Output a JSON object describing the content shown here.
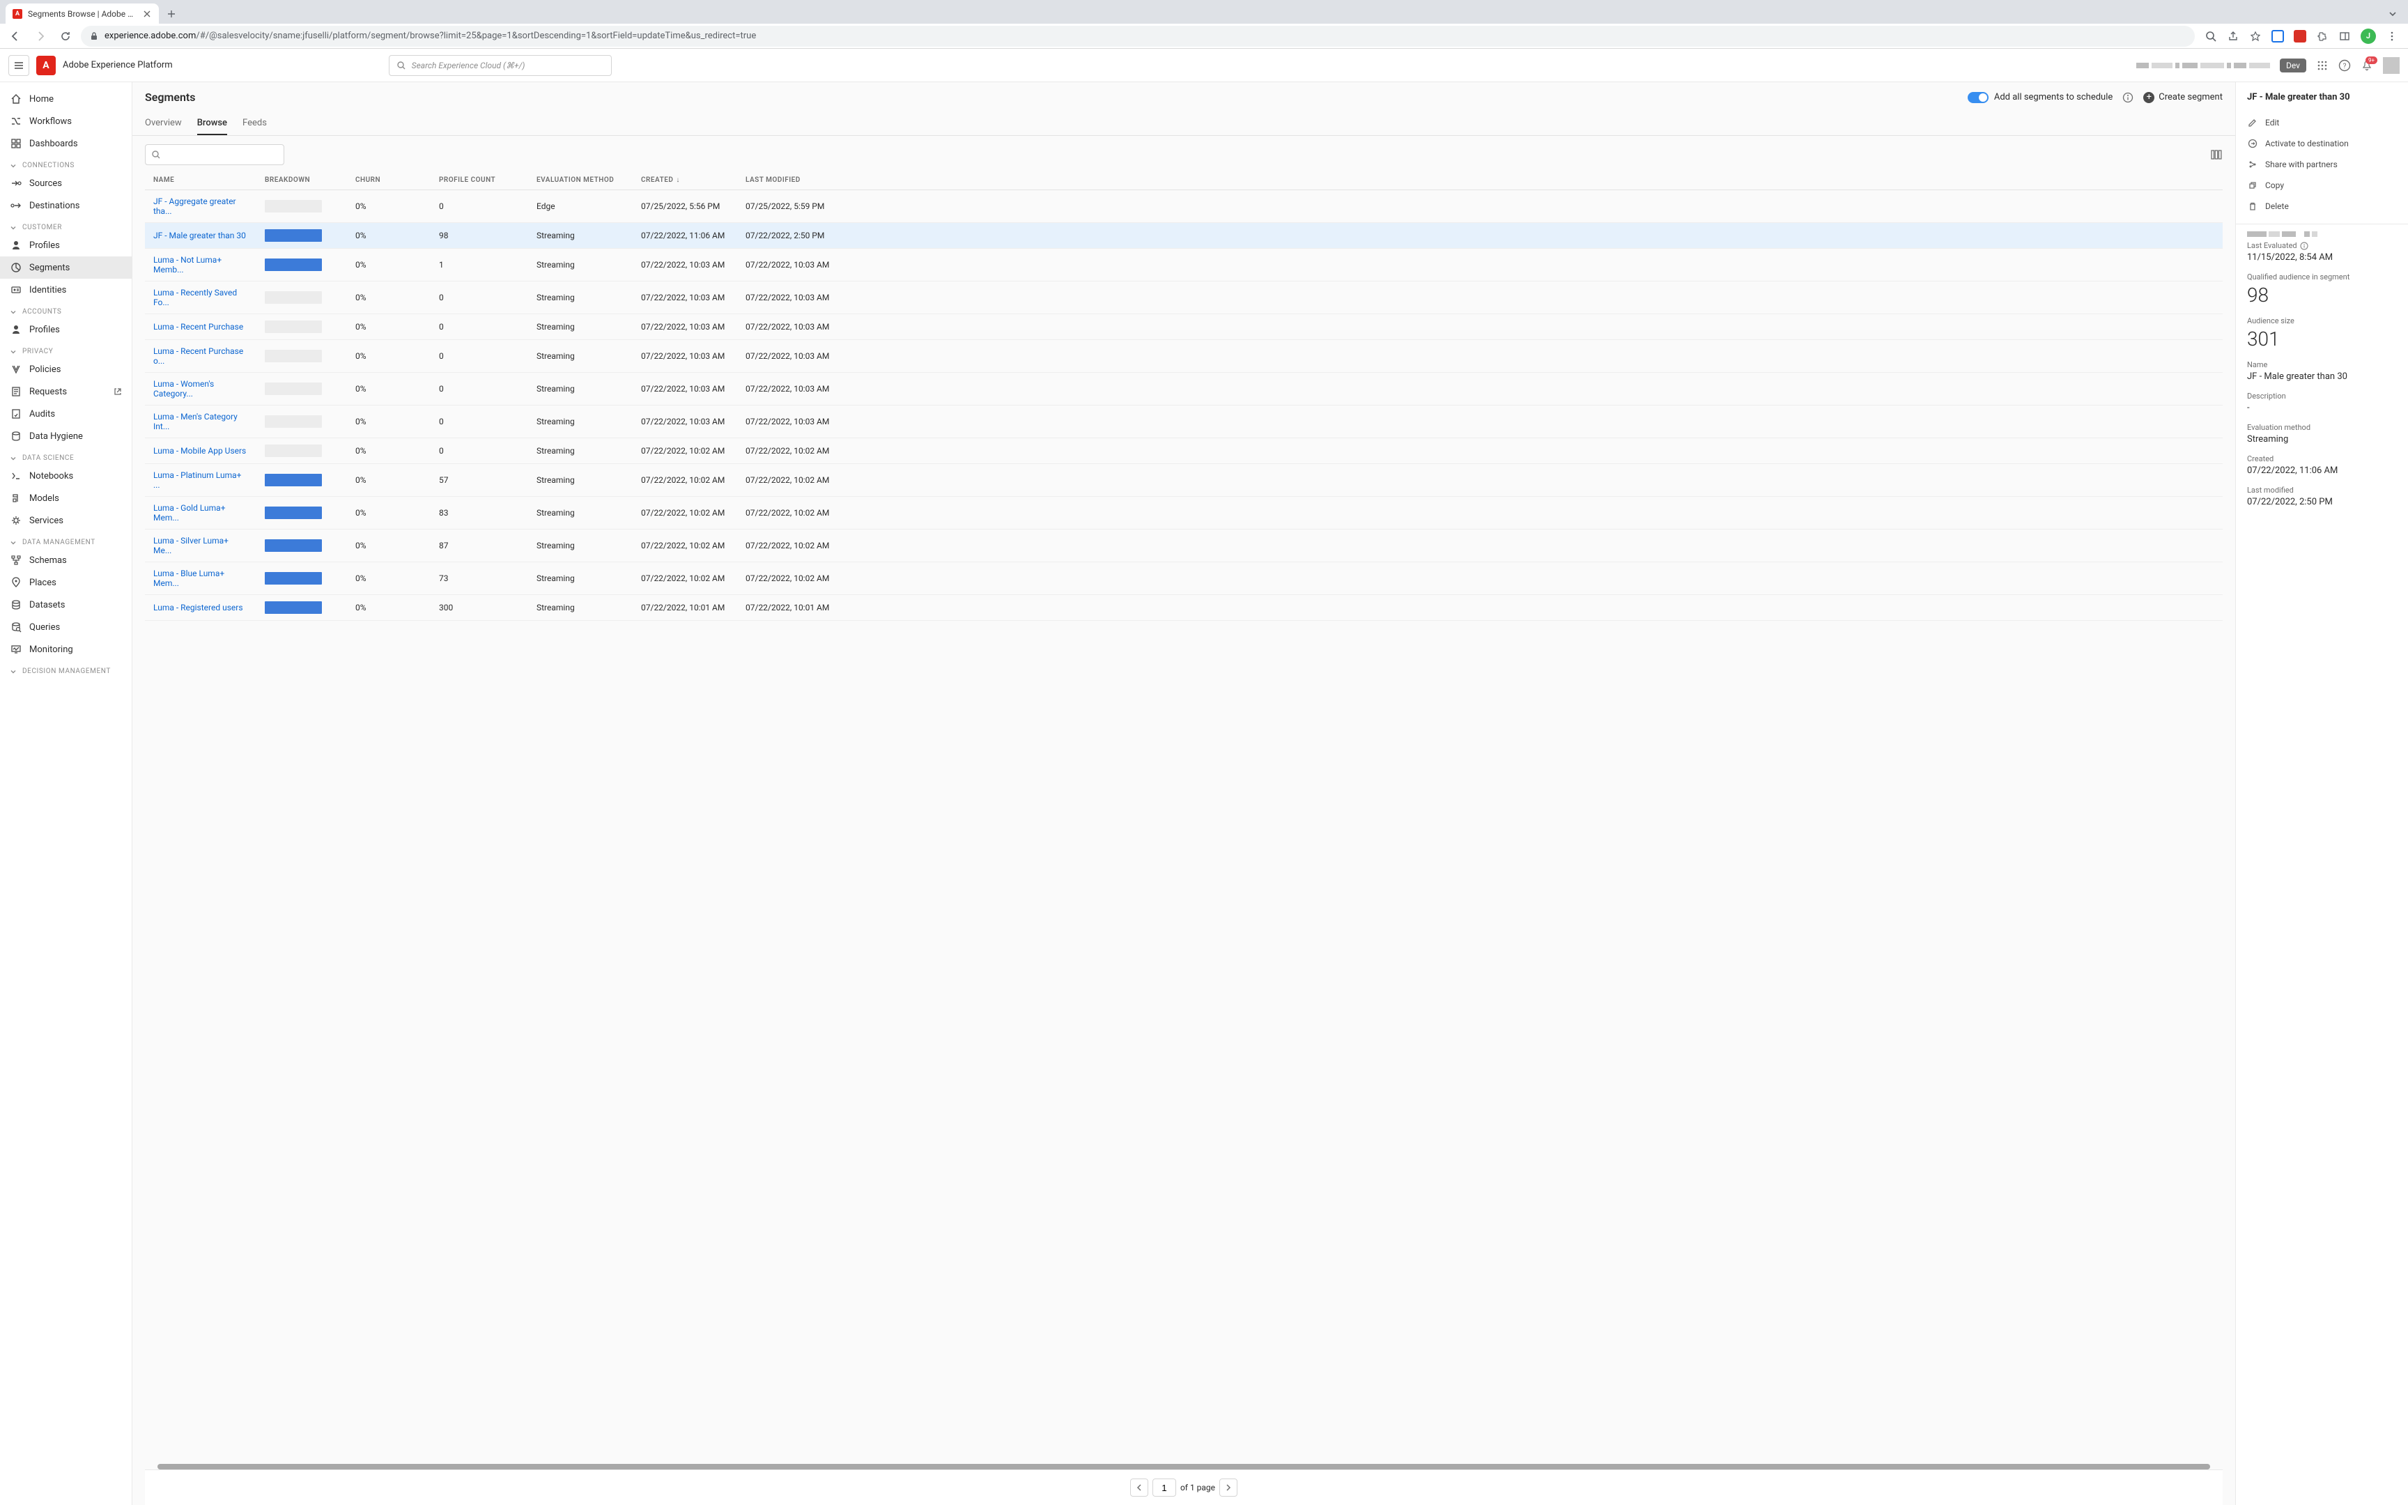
{
  "browser": {
    "tab_title": "Segments Browse | Adobe Exp",
    "url_domain": "experience.adobe.com",
    "url_path": "/#/@salesvelocity/sname:jfuselli/platform/segment/browse?limit=25&page=1&sortDescending=1&sortField=updateTime&us_redirect=true",
    "avatar_letter": "J"
  },
  "header": {
    "app_name": "Adobe Experience Platform",
    "search_placeholder": "Search Experience Cloud (⌘+/)",
    "dev_badge": "Dev",
    "notif_count": "9+"
  },
  "sidebar": {
    "top": [
      {
        "label": "Home"
      },
      {
        "label": "Workflows"
      },
      {
        "label": "Dashboards"
      }
    ],
    "groups": [
      {
        "title": "CONNECTIONS",
        "items": [
          {
            "label": "Sources"
          },
          {
            "label": "Destinations"
          }
        ]
      },
      {
        "title": "CUSTOMER",
        "items": [
          {
            "label": "Profiles"
          },
          {
            "label": "Segments",
            "active": true
          },
          {
            "label": "Identities"
          }
        ]
      },
      {
        "title": "ACCOUNTS",
        "items": [
          {
            "label": "Profiles"
          }
        ]
      },
      {
        "title": "PRIVACY",
        "items": [
          {
            "label": "Policies"
          },
          {
            "label": "Requests",
            "ext": true
          },
          {
            "label": "Audits"
          },
          {
            "label": "Data Hygiene"
          }
        ]
      },
      {
        "title": "DATA SCIENCE",
        "items": [
          {
            "label": "Notebooks"
          },
          {
            "label": "Models"
          },
          {
            "label": "Services"
          }
        ]
      },
      {
        "title": "DATA MANAGEMENT",
        "items": [
          {
            "label": "Schemas"
          },
          {
            "label": "Places"
          },
          {
            "label": "Datasets"
          },
          {
            "label": "Queries"
          },
          {
            "label": "Monitoring"
          }
        ]
      },
      {
        "title": "DECISION MANAGEMENT",
        "items": []
      }
    ]
  },
  "page": {
    "title": "Segments",
    "toggle_label": "Add all segments to schedule",
    "create_label": "Create segment",
    "tabs": [
      {
        "label": "Overview"
      },
      {
        "label": "Browse",
        "active": true
      },
      {
        "label": "Feeds"
      }
    ]
  },
  "table": {
    "headers": {
      "name": "NAME",
      "breakdown": "BREAKDOWN",
      "churn": "CHURN",
      "profile_count": "PROFILE COUNT",
      "evaluation_method": "EVALUATION METHOD",
      "created": "CREATED",
      "last_modified": "LAST MODIFIED"
    },
    "rows": [
      {
        "name": "JF - Aggregate greater tha...",
        "blue": false,
        "churn": "0%",
        "count": "0",
        "method": "Edge",
        "created": "07/25/2022, 5:56 PM",
        "modified": "07/25/2022, 5:59 PM"
      },
      {
        "name": "JF - Male greater than 30",
        "blue": true,
        "churn": "0%",
        "count": "98",
        "method": "Streaming",
        "created": "07/22/2022, 11:06 AM",
        "modified": "07/22/2022, 2:50 PM",
        "selected": true
      },
      {
        "name": "Luma - Not Luma+ Memb...",
        "blue": true,
        "churn": "0%",
        "count": "1",
        "method": "Streaming",
        "created": "07/22/2022, 10:03 AM",
        "modified": "07/22/2022, 10:03 AM"
      },
      {
        "name": "Luma - Recently Saved Fo...",
        "blue": false,
        "churn": "0%",
        "count": "0",
        "method": "Streaming",
        "created": "07/22/2022, 10:03 AM",
        "modified": "07/22/2022, 10:03 AM"
      },
      {
        "name": "Luma - Recent Purchase",
        "blue": false,
        "churn": "0%",
        "count": "0",
        "method": "Streaming",
        "created": "07/22/2022, 10:03 AM",
        "modified": "07/22/2022, 10:03 AM"
      },
      {
        "name": "Luma - Recent Purchase o...",
        "blue": false,
        "churn": "0%",
        "count": "0",
        "method": "Streaming",
        "created": "07/22/2022, 10:03 AM",
        "modified": "07/22/2022, 10:03 AM"
      },
      {
        "name": "Luma - Women's Category...",
        "blue": false,
        "churn": "0%",
        "count": "0",
        "method": "Streaming",
        "created": "07/22/2022, 10:03 AM",
        "modified": "07/22/2022, 10:03 AM"
      },
      {
        "name": "Luma - Men's Category Int...",
        "blue": false,
        "churn": "0%",
        "count": "0",
        "method": "Streaming",
        "created": "07/22/2022, 10:03 AM",
        "modified": "07/22/2022, 10:03 AM"
      },
      {
        "name": "Luma - Mobile App Users",
        "blue": false,
        "churn": "0%",
        "count": "0",
        "method": "Streaming",
        "created": "07/22/2022, 10:02 AM",
        "modified": "07/22/2022, 10:02 AM"
      },
      {
        "name": "Luma - Platinum Luma+ ...",
        "blue": true,
        "churn": "0%",
        "count": "57",
        "method": "Streaming",
        "created": "07/22/2022, 10:02 AM",
        "modified": "07/22/2022, 10:02 AM"
      },
      {
        "name": "Luma - Gold Luma+ Mem...",
        "blue": true,
        "churn": "0%",
        "count": "83",
        "method": "Streaming",
        "created": "07/22/2022, 10:02 AM",
        "modified": "07/22/2022, 10:02 AM"
      },
      {
        "name": "Luma - Silver Luma+ Me...",
        "blue": true,
        "churn": "0%",
        "count": "87",
        "method": "Streaming",
        "created": "07/22/2022, 10:02 AM",
        "modified": "07/22/2022, 10:02 AM"
      },
      {
        "name": "Luma - Blue Luma+ Mem...",
        "blue": true,
        "churn": "0%",
        "count": "73",
        "method": "Streaming",
        "created": "07/22/2022, 10:02 AM",
        "modified": "07/22/2022, 10:02 AM"
      },
      {
        "name": "Luma - Registered users",
        "blue": true,
        "churn": "0%",
        "count": "300",
        "method": "Streaming",
        "created": "07/22/2022, 10:01 AM",
        "modified": "07/22/2022, 10:01 AM"
      }
    ]
  },
  "pagination": {
    "page": "1",
    "of_text": "of 1 page"
  },
  "detail": {
    "title": "JF - Male greater than 30",
    "actions": [
      {
        "label": "Edit"
      },
      {
        "label": "Activate to destination"
      },
      {
        "label": "Share with partners"
      },
      {
        "label": "Copy"
      },
      {
        "label": "Delete"
      }
    ],
    "last_evaluated_label": "Last Evaluated",
    "last_evaluated": "11/15/2022, 8:54 AM",
    "qualified_label": "Qualified audience in segment",
    "qualified": "98",
    "audience_size_label": "Audience size",
    "audience_size": "301",
    "name_label": "Name",
    "name": "JF - Male greater than 30",
    "desc_label": "Description",
    "desc": "-",
    "eval_label": "Evaluation method",
    "eval": "Streaming",
    "created_label": "Created",
    "created": "07/22/2022, 11:06 AM",
    "modified_label": "Last modified",
    "modified": "07/22/2022, 2:50 PM"
  }
}
